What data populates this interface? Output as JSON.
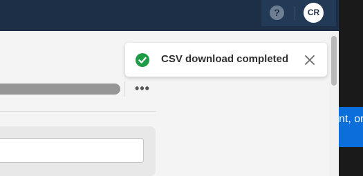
{
  "header": {
    "help_icon_glyph": "?",
    "avatar_initials": "CR"
  },
  "toast": {
    "message": "CSV download completed",
    "status_color": "#1e9c45"
  },
  "toolbar": {
    "more_glyph": "•••"
  },
  "text_input": {
    "value": ""
  },
  "side_panel": {
    "text": "nt, or"
  }
}
